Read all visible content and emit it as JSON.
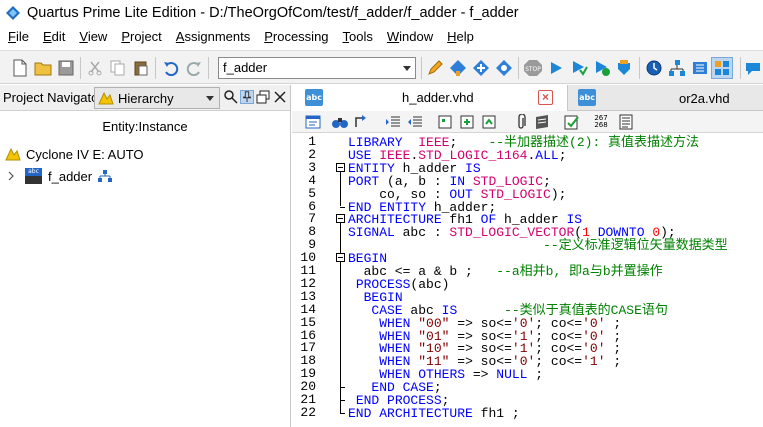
{
  "window": {
    "title": "Quartus Prime Lite Edition - D:/TheOrgOfCom/test/f_adder/f_adder - f_adder"
  },
  "menu": [
    {
      "label": "File",
      "acc": "F",
      "rest": "ile"
    },
    {
      "label": "Edit",
      "acc": "E",
      "rest": "dit"
    },
    {
      "label": "View",
      "acc": "V",
      "rest": "iew"
    },
    {
      "label": "Project",
      "acc": "P",
      "rest": "roject"
    },
    {
      "label": "Assignments",
      "acc": "A",
      "rest": "ssignments"
    },
    {
      "label": "Processing",
      "acc": "P",
      "rest": "rocessing"
    },
    {
      "label": "Tools",
      "acc": "T",
      "rest": "ools"
    },
    {
      "label": "Window",
      "acc": "W",
      "rest": "indow"
    },
    {
      "label": "Help",
      "acc": "H",
      "rest": "elp"
    }
  ],
  "toolbar": {
    "revision_value": "f_adder",
    "stop_label": "STOP"
  },
  "left_panel": {
    "title": "Project Navigator",
    "view_select": "Hierarchy",
    "column_header": "Entity:Instance",
    "device": "Cyclone IV E: AUTO",
    "top_entity": "f_adder",
    "entity_icon_text": "abc"
  },
  "tabs": [
    {
      "label": "h_adder.vhd",
      "icon_text": "abc",
      "active": true
    },
    {
      "label": "or2a.vhd",
      "icon_text": "abc",
      "active": false
    }
  ],
  "editor_toolbar": {
    "line_number_icon_text": "267\n268"
  },
  "code": {
    "line_numbers": [
      "1",
      "2",
      "3",
      "4",
      "5",
      "6",
      "7",
      "8",
      "9",
      "10",
      "11",
      "12",
      "13",
      "14",
      "15",
      "16",
      "17",
      "18",
      "19",
      "20",
      "21",
      "22"
    ],
    "lines": [
      [
        {
          "t": "kw",
          "v": "LIBRARY"
        },
        {
          "t": "tx",
          "v": "  "
        },
        {
          "t": "ty",
          "v": "IEEE"
        },
        {
          "t": "tx",
          "v": ";    "
        },
        {
          "t": "cm",
          "v": "--半加器描述(2): 真值表描述方法"
        }
      ],
      [
        {
          "t": "kw",
          "v": "USE"
        },
        {
          "t": "tx",
          "v": " "
        },
        {
          "t": "ty",
          "v": "IEEE"
        },
        {
          "t": "tx",
          "v": "."
        },
        {
          "t": "ty",
          "v": "STD_LOGIC_1164"
        },
        {
          "t": "tx",
          "v": "."
        },
        {
          "t": "kw",
          "v": "ALL"
        },
        {
          "t": "tx",
          "v": ";"
        }
      ],
      [
        {
          "t": "kw",
          "v": "ENTITY"
        },
        {
          "t": "tx",
          "v": " h_adder "
        },
        {
          "t": "kw",
          "v": "IS"
        }
      ],
      [
        {
          "t": "kw",
          "v": "PORT"
        },
        {
          "t": "tx",
          "v": " (a, b : "
        },
        {
          "t": "kw",
          "v": "IN"
        },
        {
          "t": "tx",
          "v": " "
        },
        {
          "t": "ty",
          "v": "STD_LOGIC"
        },
        {
          "t": "tx",
          "v": ";"
        }
      ],
      [
        {
          "t": "tx",
          "v": "    co, so : "
        },
        {
          "t": "kw",
          "v": "OUT"
        },
        {
          "t": "tx",
          "v": " "
        },
        {
          "t": "ty",
          "v": "STD_LOGIC"
        },
        {
          "t": "tx",
          "v": ");"
        }
      ],
      [
        {
          "t": "kw",
          "v": "END"
        },
        {
          "t": "tx",
          "v": " "
        },
        {
          "t": "kw",
          "v": "ENTITY"
        },
        {
          "t": "tx",
          "v": " h_adder;"
        }
      ],
      [
        {
          "t": "kw",
          "v": "ARCHITECTURE"
        },
        {
          "t": "tx",
          "v": " fh1 "
        },
        {
          "t": "kw",
          "v": "OF"
        },
        {
          "t": "tx",
          "v": " h_adder "
        },
        {
          "t": "kw",
          "v": "IS"
        }
      ],
      [
        {
          "t": "kw",
          "v": "SIGNAL"
        },
        {
          "t": "tx",
          "v": " abc : "
        },
        {
          "t": "ty",
          "v": "STD_LOGIC_VECTOR"
        },
        {
          "t": "tx",
          "v": "("
        },
        {
          "t": "nm",
          "v": "1"
        },
        {
          "t": "tx",
          "v": " "
        },
        {
          "t": "kw",
          "v": "DOWNTO"
        },
        {
          "t": "tx",
          "v": " "
        },
        {
          "t": "nm",
          "v": "0"
        },
        {
          "t": "tx",
          "v": ");"
        }
      ],
      [
        {
          "t": "tx",
          "v": "                         "
        },
        {
          "t": "cm",
          "v": "--定义标准逻辑位矢量数据类型"
        }
      ],
      [
        {
          "t": "kw",
          "v": "BEGIN"
        }
      ],
      [
        {
          "t": "tx",
          "v": "  abc <= a & b ;   "
        },
        {
          "t": "cm",
          "v": "--a相并b, 即a与b并置操作"
        }
      ],
      [
        {
          "t": "tx",
          "v": " "
        },
        {
          "t": "kw",
          "v": "PROCESS"
        },
        {
          "t": "tx",
          "v": "(abc)"
        }
      ],
      [
        {
          "t": "tx",
          "v": "  "
        },
        {
          "t": "kw",
          "v": "BEGIN"
        }
      ],
      [
        {
          "t": "tx",
          "v": "   "
        },
        {
          "t": "kw",
          "v": "CASE"
        },
        {
          "t": "tx",
          "v": " abc "
        },
        {
          "t": "kw",
          "v": "IS"
        },
        {
          "t": "tx",
          "v": "      "
        },
        {
          "t": "cm",
          "v": "--类似于真值表的CASE语句"
        }
      ],
      [
        {
          "t": "tx",
          "v": "    "
        },
        {
          "t": "kw",
          "v": "WHEN"
        },
        {
          "t": "tx",
          "v": " "
        },
        {
          "t": "st",
          "v": "\"00\""
        },
        {
          "t": "tx",
          "v": " => so<="
        },
        {
          "t": "st",
          "v": "'0'"
        },
        {
          "t": "tx",
          "v": "; co<="
        },
        {
          "t": "st",
          "v": "'0'"
        },
        {
          "t": "tx",
          "v": " ;"
        }
      ],
      [
        {
          "t": "tx",
          "v": "    "
        },
        {
          "t": "kw",
          "v": "WHEN"
        },
        {
          "t": "tx",
          "v": " "
        },
        {
          "t": "st",
          "v": "\"01\""
        },
        {
          "t": "tx",
          "v": " => so<="
        },
        {
          "t": "st",
          "v": "'1'"
        },
        {
          "t": "tx",
          "v": "; co<="
        },
        {
          "t": "st",
          "v": "'0'"
        },
        {
          "t": "tx",
          "v": " ;"
        }
      ],
      [
        {
          "t": "tx",
          "v": "    "
        },
        {
          "t": "kw",
          "v": "WHEN"
        },
        {
          "t": "tx",
          "v": " "
        },
        {
          "t": "st",
          "v": "\"10\""
        },
        {
          "t": "tx",
          "v": " => so<="
        },
        {
          "t": "st",
          "v": "'1'"
        },
        {
          "t": "tx",
          "v": "; co<="
        },
        {
          "t": "st",
          "v": "'0'"
        },
        {
          "t": "tx",
          "v": " ;"
        }
      ],
      [
        {
          "t": "tx",
          "v": "    "
        },
        {
          "t": "kw",
          "v": "WHEN"
        },
        {
          "t": "tx",
          "v": " "
        },
        {
          "t": "st",
          "v": "\"11\""
        },
        {
          "t": "tx",
          "v": " => so<="
        },
        {
          "t": "st",
          "v": "'0'"
        },
        {
          "t": "tx",
          "v": "; co<="
        },
        {
          "t": "st",
          "v": "'1'"
        },
        {
          "t": "tx",
          "v": " ;"
        }
      ],
      [
        {
          "t": "tx",
          "v": "    "
        },
        {
          "t": "kw",
          "v": "WHEN"
        },
        {
          "t": "tx",
          "v": " "
        },
        {
          "t": "kw",
          "v": "OTHERS"
        },
        {
          "t": "tx",
          "v": " => "
        },
        {
          "t": "kw",
          "v": "NULL"
        },
        {
          "t": "tx",
          "v": " ;"
        }
      ],
      [
        {
          "t": "tx",
          "v": "   "
        },
        {
          "t": "kw",
          "v": "END"
        },
        {
          "t": "tx",
          "v": " "
        },
        {
          "t": "kw",
          "v": "CASE"
        },
        {
          "t": "tx",
          "v": ";"
        }
      ],
      [
        {
          "t": "tx",
          "v": " "
        },
        {
          "t": "kw",
          "v": "END"
        },
        {
          "t": "tx",
          "v": " "
        },
        {
          "t": "kw",
          "v": "PROCESS"
        },
        {
          "t": "tx",
          "v": ";"
        }
      ],
      [
        {
          "t": "kw",
          "v": "END"
        },
        {
          "t": "tx",
          "v": " "
        },
        {
          "t": "kw",
          "v": "ARCHITECTURE"
        },
        {
          "t": "tx",
          "v": " fh1 ;"
        }
      ]
    ]
  },
  "colors": {
    "keyword": "#0000ff",
    "type": "#d5006f",
    "comment": "#008000",
    "string": "#7f0000",
    "number": "#ff0000"
  }
}
